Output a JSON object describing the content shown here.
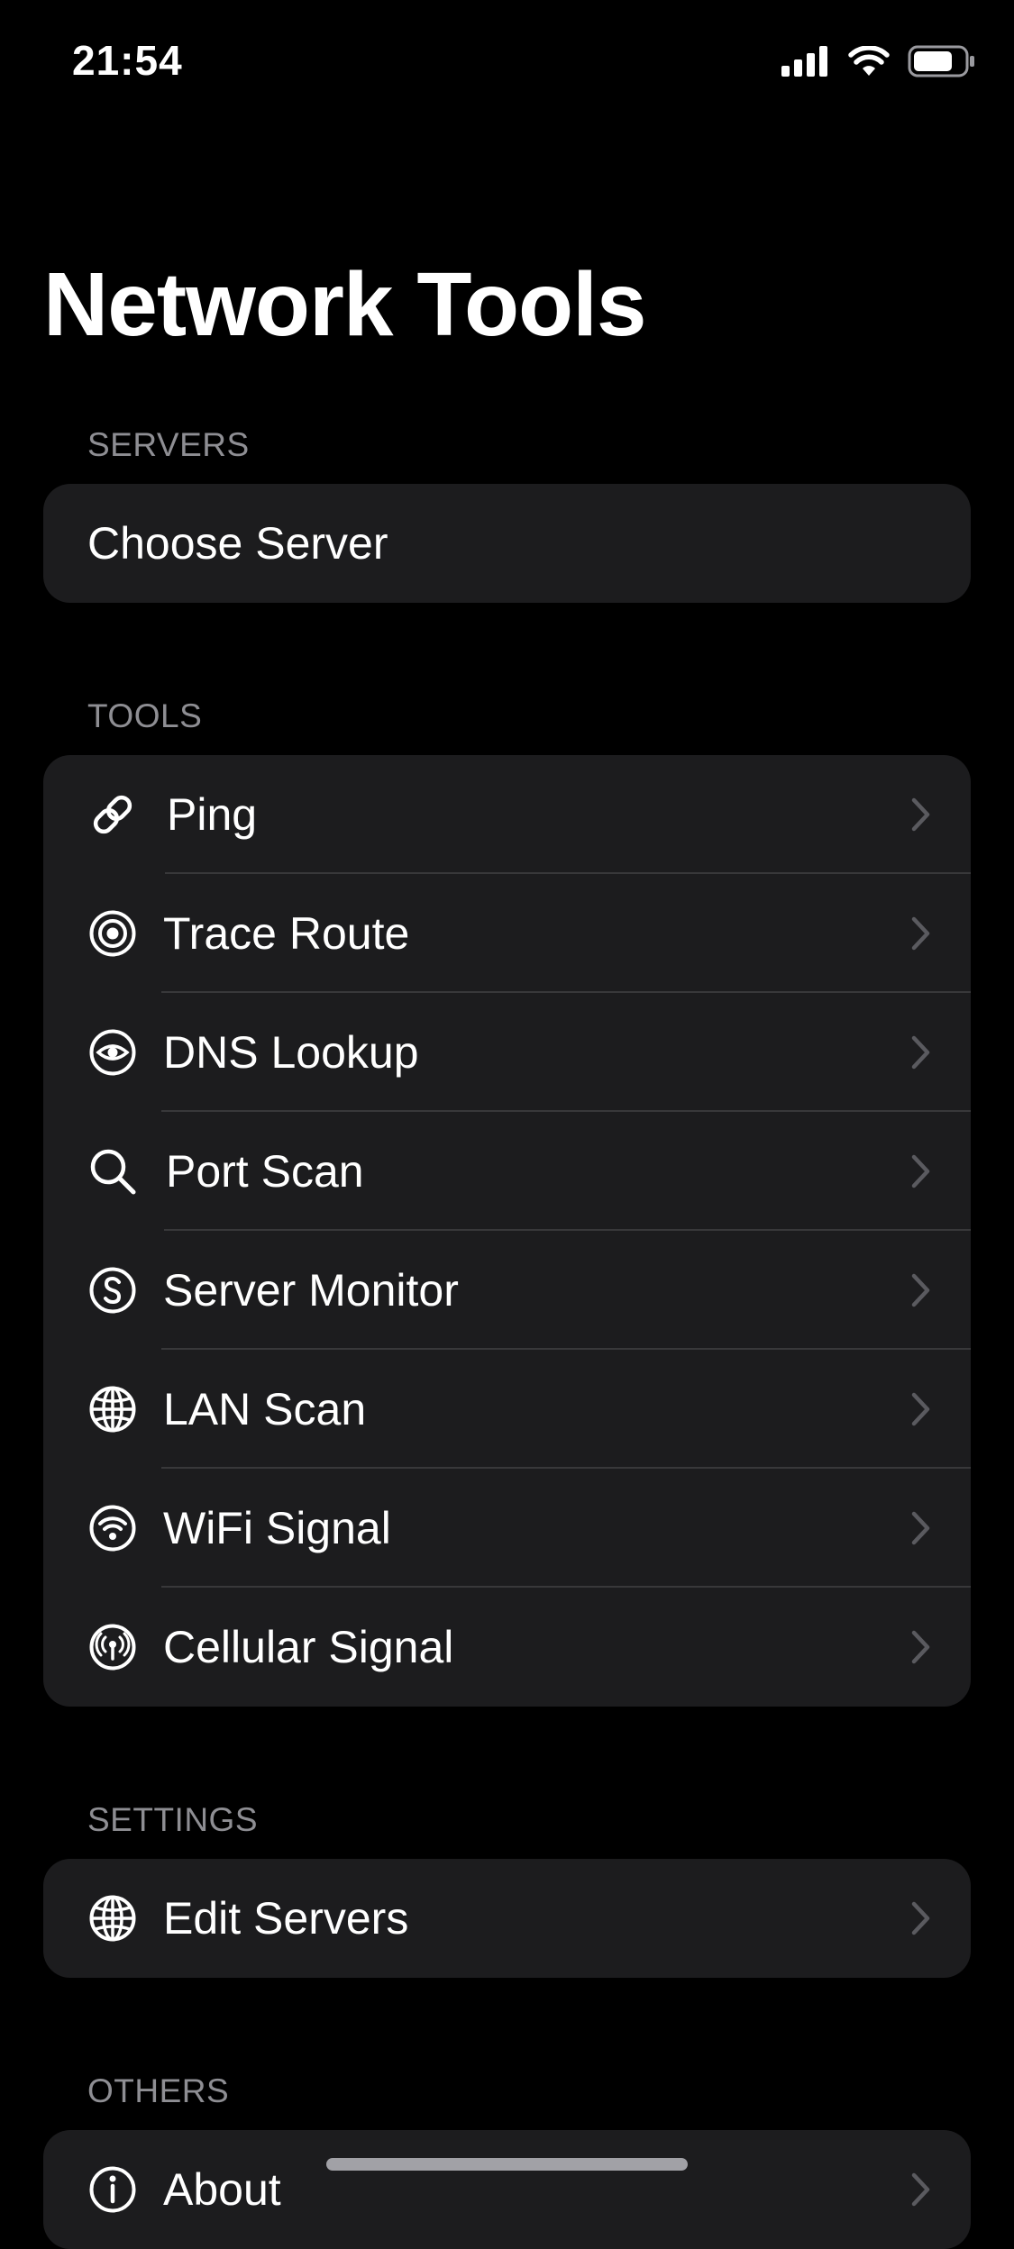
{
  "status_bar": {
    "time": "21:54",
    "icons": [
      "cellular-signal-icon",
      "wifi-icon",
      "battery-icon"
    ]
  },
  "page": {
    "title": "Network Tools"
  },
  "sections": {
    "servers": {
      "header": "SERVERS",
      "items": [
        {
          "label": "Choose Server"
        }
      ]
    },
    "tools": {
      "header": "TOOLS",
      "items": [
        {
          "label": "Ping",
          "icon": "link-icon"
        },
        {
          "label": "Trace Route",
          "icon": "target-icon"
        },
        {
          "label": "DNS Lookup",
          "icon": "eye-icon"
        },
        {
          "label": "Port Scan",
          "icon": "magnifier-icon"
        },
        {
          "label": "Server Monitor",
          "icon": "s-circle-icon"
        },
        {
          "label": "LAN Scan",
          "icon": "globe-icon"
        },
        {
          "label": "WiFi Signal",
          "icon": "wifi-circle-icon"
        },
        {
          "label": "Cellular Signal",
          "icon": "antenna-circle-icon"
        }
      ]
    },
    "settings": {
      "header": "SETTINGS",
      "items": [
        {
          "label": "Edit Servers",
          "icon": "globe-icon"
        }
      ]
    },
    "others": {
      "header": "OTHERS",
      "items": [
        {
          "label": "About",
          "icon": "info-icon"
        }
      ]
    }
  },
  "colors": {
    "background": "#000000",
    "group_background": "#1c1c1e",
    "separator": "#38383a",
    "secondary_text": "#8e8e93",
    "chevron": "#5a5a5f",
    "primary_text": "#ffffff"
  }
}
